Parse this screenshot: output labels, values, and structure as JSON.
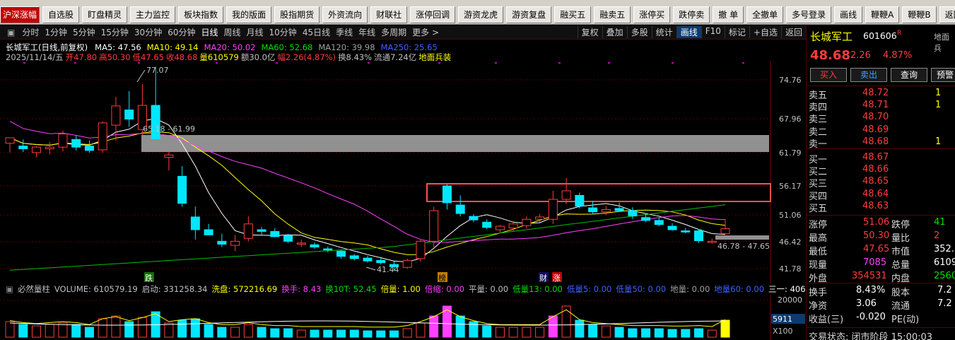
{
  "toolbar": {
    "buttons": [
      "沪深涨幅",
      "自选股",
      "盯盘精灵",
      "主力监控",
      "板块指数",
      "我的版面",
      "股指期货",
      "外资流向",
      "财联社",
      "涨停回调",
      "游资龙虎",
      "游资复盘",
      "融买五",
      "融卖五",
      "涨停买",
      "跌停卖",
      "撤 单",
      "全撤单",
      "多号登录",
      "画线",
      "鞭鞭A",
      "鞭鞭B",
      "返回"
    ]
  },
  "tabs": {
    "left": [
      "分时",
      "1分钟",
      "5分钟",
      "15分钟",
      "30分钟",
      "60分钟",
      "日线",
      "周线",
      "月线",
      "10分钟",
      "45日线",
      "季线",
      "年线",
      "多周期",
      "更多 >"
    ],
    "active": "日线",
    "right": [
      "复权",
      "叠加",
      "多股",
      "统计",
      "画线",
      "F10",
      "标记",
      "+自选",
      "返回"
    ],
    "right_active": "画线"
  },
  "info": {
    "title": "长城军工(日线,前复权)",
    "ma": [
      {
        "label": "MA5: 47.56",
        "color": "#ffffff"
      },
      {
        "label": "MA10: 49.14",
        "color": "#ffff00"
      },
      {
        "label": "MA20: 50.02",
        "color": "#ff40ff"
      },
      {
        "label": "MA60: 52.68",
        "color": "#00e000"
      },
      {
        "label": "MA120: 39.98",
        "color": "#a0a0a0"
      },
      {
        "label": "MA250: 25.65",
        "color": "#4060ff"
      }
    ],
    "line2": [
      {
        "t": "2025/11/14/五",
        "c": "#c0c0c0"
      },
      {
        "t": "开47.80",
        "c": "#ff3c3c"
      },
      {
        "t": "高50.30",
        "c": "#ff3c3c"
      },
      {
        "t": "低47.65",
        "c": "#ff3c3c"
      },
      {
        "t": "收48.68",
        "c": "#ff3c3c"
      },
      {
        "t": "量610579",
        "c": "#ffff00"
      },
      {
        "t": "额30.0亿",
        "c": "#c0c0c0"
      },
      {
        "t": "幅2.26(4.87%)",
        "c": "#ff3c3c"
      },
      {
        "t": "换8.43%",
        "c": "#c0c0c0"
      },
      {
        "t": "流通7.24亿",
        "c": "#c0c0c0"
      },
      {
        "t": "地面兵装",
        "c": "#ffff00"
      }
    ]
  },
  "chart_data": {
    "type": "candlestick",
    "symbol": "长城军工",
    "period": "日线",
    "y_axis_labels": [
      "74.76",
      "67.96",
      "61.79",
      "56.17",
      "51.06",
      "46.42",
      "41.78"
    ],
    "candles": [
      {
        "o": 63.5,
        "h": 64.5,
        "l": 61.8,
        "c": 64.5
      },
      {
        "o": 63.0,
        "h": 64.2,
        "l": 61.9,
        "c": 62.5
      },
      {
        "o": 61.8,
        "h": 63.0,
        "l": 61.0,
        "c": 62.8
      },
      {
        "o": 62.5,
        "h": 63.8,
        "l": 61.5,
        "c": 62.8
      },
      {
        "o": 62.8,
        "h": 65.8,
        "l": 62.0,
        "c": 65.2
      },
      {
        "o": 64.2,
        "h": 65.0,
        "l": 62.2,
        "c": 62.8
      },
      {
        "o": 63.0,
        "h": 64.0,
        "l": 61.8,
        "c": 62.2
      },
      {
        "o": 62.3,
        "h": 67.5,
        "l": 61.8,
        "c": 67.2
      },
      {
        "o": 66.8,
        "h": 71.8,
        "l": 64.0,
        "c": 70.2
      },
      {
        "o": 69.5,
        "h": 72.8,
        "l": 66.5,
        "c": 67.9
      },
      {
        "o": 66.0,
        "h": 74.0,
        "l": 65.0,
        "c": 70.3
      },
      {
        "o": 70.3,
        "h": 77.07,
        "l": 65.2,
        "c": 64.3
      },
      {
        "o": 61.0,
        "h": 62.0,
        "l": 58.8,
        "c": 61.4
      },
      {
        "o": 57.8,
        "h": 59.5,
        "l": 52.5,
        "c": 53.1
      },
      {
        "o": 50.7,
        "h": 52.5,
        "l": 46.8,
        "c": 48.5
      },
      {
        "o": 48.5,
        "h": 49.5,
        "l": 48.0,
        "c": 47.6
      },
      {
        "o": 46.5,
        "h": 47.8,
        "l": 45.5,
        "c": 46.0
      },
      {
        "o": 45.8,
        "h": 47.6,
        "l": 44.8,
        "c": 46.5
      },
      {
        "o": 47.0,
        "h": 50.8,
        "l": 46.5,
        "c": 49.5
      },
      {
        "o": 48.5,
        "h": 49.0,
        "l": 47.5,
        "c": 48.2
      },
      {
        "o": 48.2,
        "h": 48.8,
        "l": 47.2,
        "c": 47.3
      },
      {
        "o": 47.5,
        "h": 47.8,
        "l": 46.2,
        "c": 46.5
      },
      {
        "o": 46.0,
        "h": 46.8,
        "l": 45.5,
        "c": 46.2
      },
      {
        "o": 45.9,
        "h": 46.3,
        "l": 45.2,
        "c": 45.5
      },
      {
        "o": 45.2,
        "h": 45.6,
        "l": 44.6,
        "c": 45.0
      },
      {
        "o": 44.8,
        "h": 45.0,
        "l": 43.5,
        "c": 43.9
      },
      {
        "o": 44.0,
        "h": 44.3,
        "l": 43.2,
        "c": 43.5
      },
      {
        "o": 43.6,
        "h": 44.0,
        "l": 42.8,
        "c": 43.1
      },
      {
        "o": 43.2,
        "h": 43.6,
        "l": 42.5,
        "c": 42.8
      },
      {
        "o": 42.5,
        "h": 43.0,
        "l": 41.44,
        "c": 42.1
      },
      {
        "o": 42.0,
        "h": 43.5,
        "l": 41.8,
        "c": 43.2
      },
      {
        "o": 43.5,
        "h": 46.8,
        "l": 43.0,
        "c": 46.5
      },
      {
        "o": 46.5,
        "h": 52.5,
        "l": 45.5,
        "c": 51.8
      },
      {
        "o": 56.17,
        "h": 56.4,
        "l": 52.0,
        "c": 53.2
      },
      {
        "o": 52.8,
        "h": 54.5,
        "l": 50.8,
        "c": 51.3
      },
      {
        "o": 50.8,
        "h": 51.2,
        "l": 49.8,
        "c": 50.2
      },
      {
        "o": 49.8,
        "h": 50.3,
        "l": 48.6,
        "c": 48.9
      },
      {
        "o": 48.5,
        "h": 49.3,
        "l": 48.0,
        "c": 49.1
      },
      {
        "o": 48.8,
        "h": 50.0,
        "l": 48.2,
        "c": 49.5
      },
      {
        "o": 49.2,
        "h": 50.8,
        "l": 48.7,
        "c": 50.3
      },
      {
        "o": 50.3,
        "h": 51.2,
        "l": 49.8,
        "c": 50.7
      },
      {
        "o": 50.3,
        "h": 55.3,
        "l": 49.5,
        "c": 53.8
      },
      {
        "o": 53.8,
        "h": 57.5,
        "l": 53.0,
        "c": 55.3
      },
      {
        "o": 54.5,
        "h": 55.0,
        "l": 52.2,
        "c": 52.6
      },
      {
        "o": 52.3,
        "h": 53.5,
        "l": 51.2,
        "c": 51.6
      },
      {
        "o": 51.6,
        "h": 52.6,
        "l": 51.0,
        "c": 52.0
      },
      {
        "o": 52.2,
        "h": 53.2,
        "l": 51.6,
        "c": 51.8
      },
      {
        "o": 51.8,
        "h": 52.4,
        "l": 50.4,
        "c": 50.9
      },
      {
        "o": 50.6,
        "h": 51.2,
        "l": 49.8,
        "c": 50.1
      },
      {
        "o": 50.1,
        "h": 50.6,
        "l": 49.1,
        "c": 49.4
      },
      {
        "o": 49.1,
        "h": 49.6,
        "l": 48.3,
        "c": 48.5
      },
      {
        "o": 48.3,
        "h": 48.8,
        "l": 47.9,
        "c": 48.1
      },
      {
        "o": 48.3,
        "h": 48.6,
        "l": 46.2,
        "c": 46.6
      },
      {
        "o": 46.3,
        "h": 47.0,
        "l": 46.1,
        "c": 46.5
      },
      {
        "o": 47.8,
        "h": 50.3,
        "l": 47.65,
        "c": 48.68
      }
    ],
    "annotations": [
      "77.07",
      "65.18 - 61.99",
      "41.44",
      "46.78 - 47.65",
      "跌",
      "榜",
      "财",
      "涨"
    ],
    "volume": {
      "labels": [
        "20000",
        "5911",
        "X100"
      ]
    }
  },
  "volbar": [
    {
      "t": "必然量柱",
      "c": "#c0c0c0"
    },
    {
      "t": "VOLUME: 610579.19",
      "c": "#c0c0c0"
    },
    {
      "t": "启动: 331258.34",
      "c": "#c0c0c0"
    },
    {
      "t": "洗盘: 572216.69",
      "c": "#ffff00"
    },
    {
      "t": "换手: 8.43",
      "c": "#ff40ff"
    },
    {
      "t": "换10T: 52.45",
      "c": "#00e000"
    },
    {
      "t": "倍量: 1.00",
      "c": "#ffff00"
    },
    {
      "t": "倍缩: 0.00",
      "c": "#ff40ff"
    },
    {
      "t": "平量: 0.00",
      "c": "#c0c0c0"
    },
    {
      "t": "低量13: 0.00",
      "c": "#00e000"
    },
    {
      "t": "低量5: 0.00",
      "c": "#4060ff"
    },
    {
      "t": "低量50: 0.00",
      "c": "#4060ff"
    },
    {
      "t": "地量: 0.00",
      "c": "#a0a0a0"
    },
    {
      "t": "地量60: 0.00",
      "c": "#4060ff"
    },
    {
      "t": "三一: 406",
      "c": "#ffffff"
    }
  ],
  "quote": {
    "name": "长城军工",
    "code": "601606",
    "corner": "地面兵",
    "price": "48.68",
    "change": "2.26",
    "pct": "4.87%",
    "buy_btn": "买入",
    "sell_btn": "卖出",
    "query_btn": "查询",
    "warn_btn": "预警",
    "asks": [
      {
        "l": "卖五",
        "p": "48.72",
        "v": "1"
      },
      {
        "l": "卖四",
        "p": "48.71",
        "v": "1"
      },
      {
        "l": "卖三",
        "p": "48.70",
        "v": ""
      },
      {
        "l": "卖二",
        "p": "48.69",
        "v": ""
      },
      {
        "l": "卖一",
        "p": "48.68",
        "v": "1"
      }
    ],
    "bids": [
      {
        "l": "买一",
        "p": "48.67",
        "v": ""
      },
      {
        "l": "买二",
        "p": "48.66",
        "v": ""
      },
      {
        "l": "买三",
        "p": "48.65",
        "v": ""
      },
      {
        "l": "买四",
        "p": "48.64",
        "v": ""
      },
      {
        "l": "买五",
        "p": "48.63",
        "v": ""
      }
    ],
    "stats": [
      {
        "l": "涨停",
        "v": "51.06",
        "l2": "跌停",
        "v2": "41"
      },
      {
        "l": "最高",
        "v": "50.30",
        "l2": "量比",
        "v2": "2"
      },
      {
        "l": "最低",
        "v": "47.65",
        "l2": "市值",
        "v2": "352."
      },
      {
        "l": "现量",
        "v": "7085",
        "l2": "总量",
        "v2": "6109"
      },
      {
        "l": "外盘",
        "v": "354531",
        "l2": "内盘",
        "v2": "2560"
      }
    ],
    "stats2": [
      {
        "l": "换手",
        "v": "8.43%",
        "l2": "股本",
        "v2": "7.2"
      },
      {
        "l": "净资",
        "v": "3.06",
        "l2": "流通",
        "v2": "7.2"
      },
      {
        "l": "收益(三)",
        "v": "-0.020",
        "l2": "PE(动)",
        "v2": ""
      }
    ],
    "status": "交易状态: 闭市阶段 15:00:03"
  }
}
